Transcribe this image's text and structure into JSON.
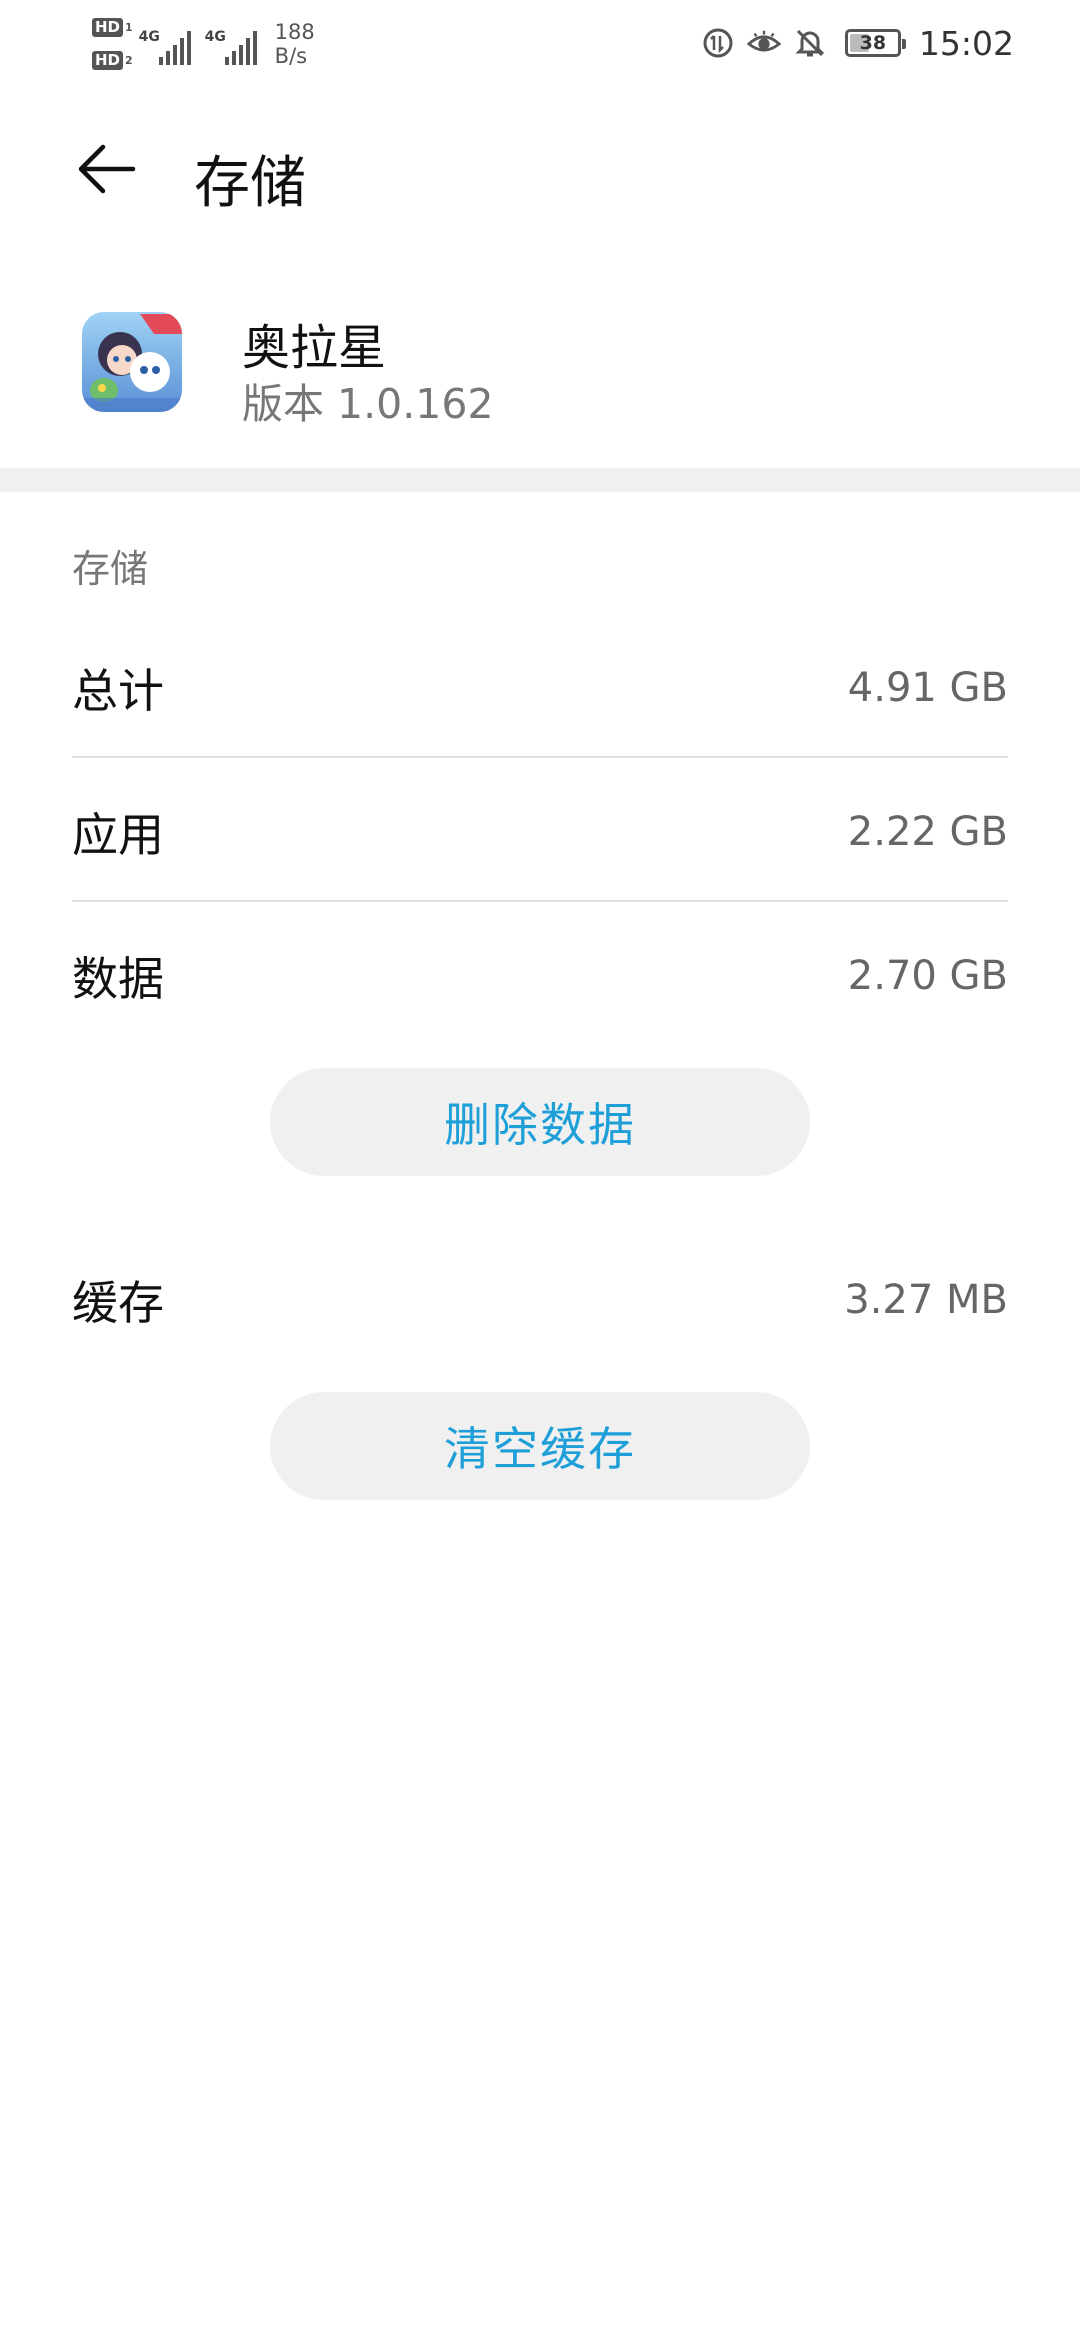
{
  "status_bar": {
    "sim1": "HD",
    "sim1_num": "1",
    "sim2": "HD",
    "sim2_num": "2",
    "net1": "4G",
    "net2": "4G",
    "speed_value": "188",
    "speed_unit": "B/s",
    "battery": "38",
    "battery_level": 0.38,
    "time": "15:02"
  },
  "app_bar": {
    "title": "存储"
  },
  "app": {
    "name": "奥拉星",
    "version": "版本 1.0.162"
  },
  "storage": {
    "section_label": "存储",
    "rows": [
      {
        "label": "总计",
        "value": "4.91 GB"
      },
      {
        "label": "应用",
        "value": "2.22 GB"
      },
      {
        "label": "数据",
        "value": "2.70 GB"
      }
    ],
    "delete_data_button": "删除数据",
    "cache": {
      "label": "缓存",
      "value": "3.27 MB"
    },
    "clear_cache_button": "清空缓存"
  },
  "colors": {
    "accent": "#1e9fd8",
    "button_bg": "#f0f0f0",
    "band": "#f1f1f1"
  }
}
